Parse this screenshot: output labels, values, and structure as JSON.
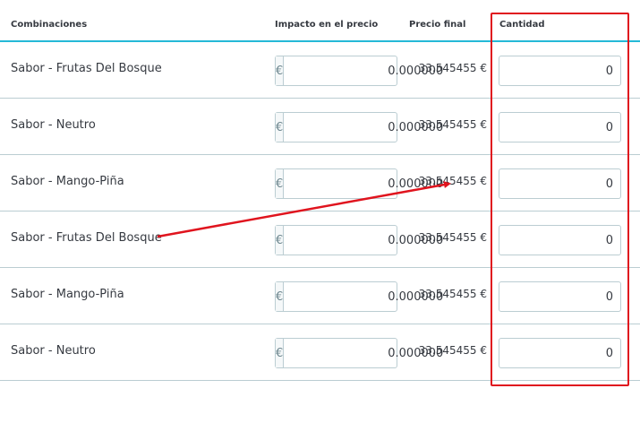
{
  "table": {
    "headers": {
      "combinations": "Combinaciones",
      "price_impact": "Impacto en el precio",
      "final_price": "Precio final",
      "quantity": "Cantidad"
    },
    "currency_symbol": "€",
    "rows": [
      {
        "name": "Sabor - Frutas Del Bosque",
        "impact": "0.000000",
        "final_price": "33.545455 €",
        "quantity": "0"
      },
      {
        "name": "Sabor - Neutro",
        "impact": "0.000000",
        "final_price": "33.545455 €",
        "quantity": "0"
      },
      {
        "name": "Sabor - Mango-Piña",
        "impact": "0.000000",
        "final_price": "33.545455 €",
        "quantity": "0"
      },
      {
        "name": "Sabor - Frutas Del Bosque",
        "impact": "0.000000",
        "final_price": "33.545455 €",
        "quantity": "0"
      },
      {
        "name": "Sabor - Mango-Piña",
        "impact": "0.000000",
        "final_price": "33.545455 €",
        "quantity": "0"
      },
      {
        "name": "Sabor - Neutro",
        "impact": "0.000000",
        "final_price": "33.545455 €",
        "quantity": "0"
      }
    ]
  },
  "colors": {
    "accent": "#25b9d7",
    "annotation": "#e0141e",
    "row_border": "#bbcdd2"
  }
}
